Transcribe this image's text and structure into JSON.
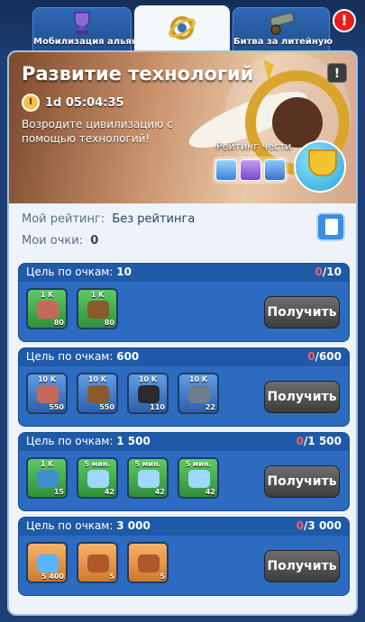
{
  "tabs": [
    {
      "label": "Мобилизация альянса",
      "icon": "trophy-icon"
    },
    {
      "label": "",
      "icon": "technology-gear-icon"
    },
    {
      "label": "Битва за литейную",
      "icon": "cannon-icon"
    }
  ],
  "alert": "!",
  "banner": {
    "title": "Развитие технологий",
    "info": "!",
    "timer": "1d 05:04:35",
    "description": "Возродите цивилизацию с помощью технологий!",
    "honor_label": "Рейтинг чести"
  },
  "rating": {
    "my_rating_label": "Мой рейтинг:",
    "my_rating_value": "Без рейтинга",
    "my_points_label": "Мои очки:",
    "my_points_value": "0"
  },
  "goals": [
    {
      "label": "Цель по очкам:",
      "target": "10",
      "current": "0",
      "max": "/10",
      "button": "Получить",
      "items": [
        {
          "tag": "1 K",
          "qty": "80",
          "color": "green",
          "icon": "meat-icon"
        },
        {
          "tag": "1 K",
          "qty": "80",
          "color": "green",
          "icon": "wood-icon"
        }
      ]
    },
    {
      "label": "Цель по очкам:",
      "target": "600",
      "current": "0",
      "max": "/600",
      "button": "Получить",
      "items": [
        {
          "tag": "10 K",
          "qty": "550",
          "color": "blue",
          "icon": "meat-icon"
        },
        {
          "tag": "10 K",
          "qty": "550",
          "color": "blue",
          "icon": "wood-icon"
        },
        {
          "tag": "10 K",
          "qty": "110",
          "color": "blue",
          "icon": "coal-icon"
        },
        {
          "tag": "10 K",
          "qty": "22",
          "color": "blue",
          "icon": "iron-icon"
        }
      ]
    },
    {
      "label": "Цель по очкам:",
      "target": "1 500",
      "current": "0",
      "max": "/1 500",
      "button": "Получить",
      "items": [
        {
          "tag": "1 K",
          "qty": "15",
          "color": "green",
          "icon": "potion-icon"
        },
        {
          "tag": "5 мин.",
          "qty": "42",
          "color": "green",
          "icon": "speedup-icon"
        },
        {
          "tag": "5 мин.",
          "qty": "42",
          "color": "green",
          "icon": "speedup-research-icon"
        },
        {
          "tag": "5 мин.",
          "qty": "42",
          "color": "green",
          "icon": "speedup-training-icon"
        }
      ]
    },
    {
      "label": "Цель по очкам:",
      "target": "3 000",
      "current": "0",
      "max": "/3 000",
      "button": "Получить",
      "items": [
        {
          "tag": "",
          "qty": "5 400",
          "color": "orange",
          "icon": "gem-icon"
        },
        {
          "tag": "",
          "qty": "5",
          "color": "orange",
          "icon": "manual-book-icon"
        },
        {
          "tag": "",
          "qty": "5",
          "color": "orange",
          "icon": "manual-book-icon"
        }
      ]
    }
  ]
}
